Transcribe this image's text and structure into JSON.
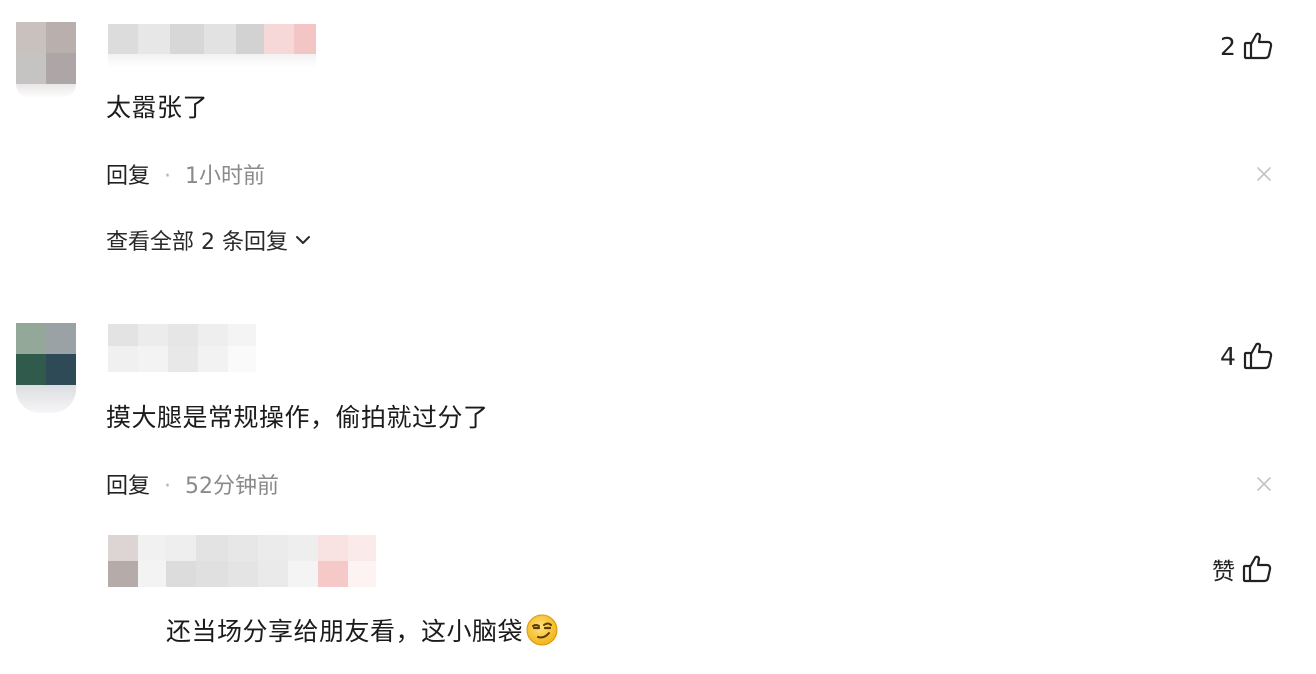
{
  "comments": [
    {
      "text": "太嚣张了",
      "likes": "2",
      "reply_label": "回复",
      "separator": "·",
      "time": "1小时前",
      "view_replies": "查看全部 2 条回复"
    },
    {
      "text": "摸大腿是常规操作，偷拍就过分了",
      "likes": "4",
      "reply_label": "回复",
      "separator": "·",
      "time": "52分钟前"
    }
  ],
  "reply": {
    "text": "还当场分享给朋友看，这小脑袋",
    "like_label": "赞",
    "emoji": "smirk-emoji"
  },
  "icons": {
    "like": "thumbs-up-icon",
    "close": "close-icon",
    "expand": "chevron-down-icon"
  },
  "colors": {
    "text": "#1b1b1b",
    "meta_gray": "#8a8a8a",
    "icon": "#222222",
    "close_gray": "#c4c4c4"
  }
}
